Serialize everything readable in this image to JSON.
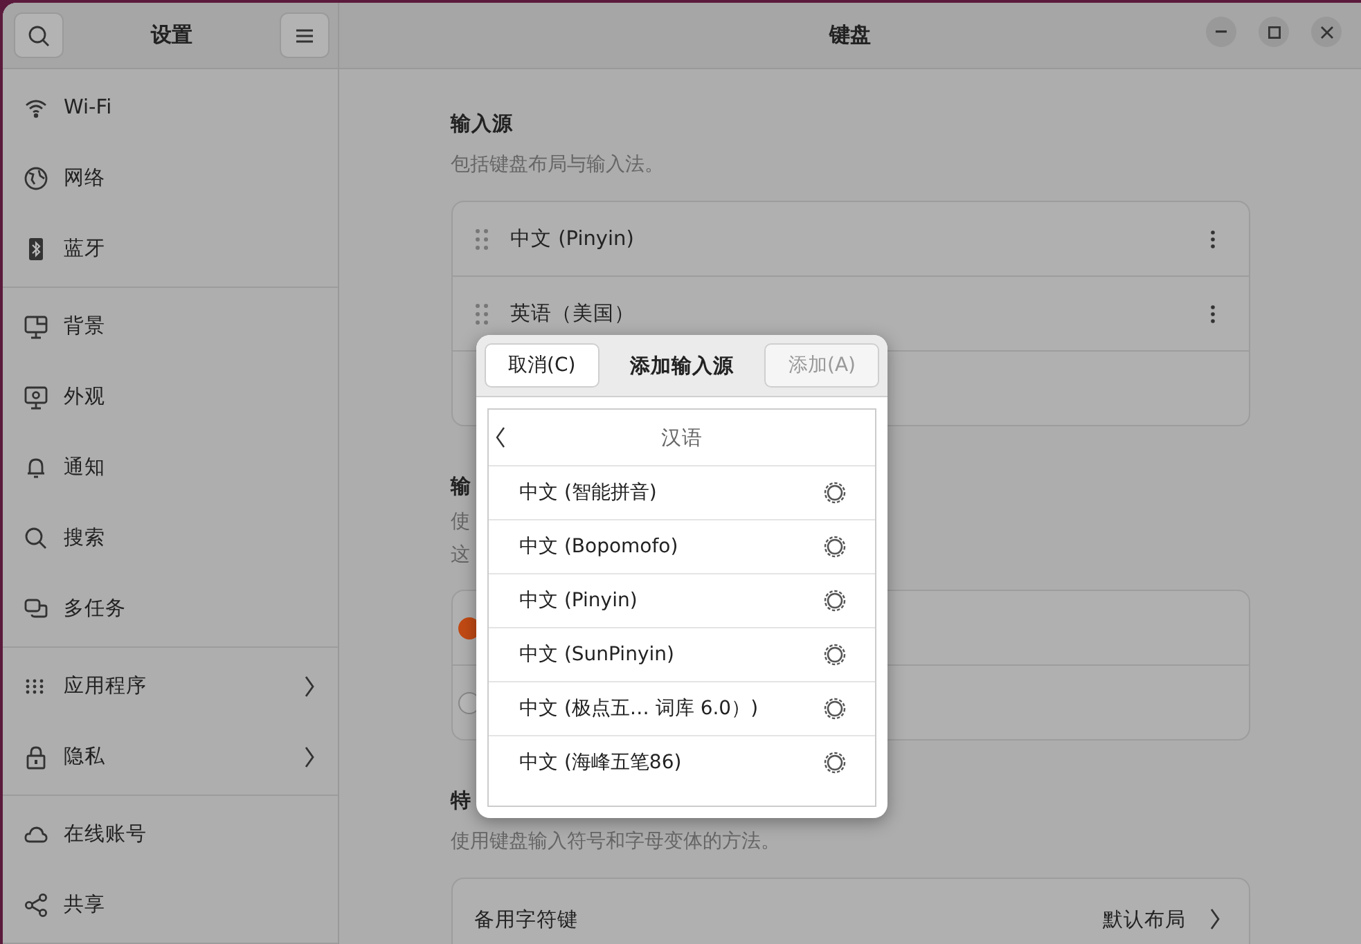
{
  "sidebar": {
    "title": "设置",
    "groups": [
      [
        {
          "label": "Wi-Fi",
          "submenu": false
        },
        {
          "label": "网络",
          "submenu": false
        },
        {
          "label": "蓝牙",
          "submenu": false
        }
      ],
      [
        {
          "label": "背景",
          "submenu": false
        },
        {
          "label": "外观",
          "submenu": false
        },
        {
          "label": "通知",
          "submenu": false
        },
        {
          "label": "搜索",
          "submenu": false
        },
        {
          "label": "多任务",
          "submenu": false
        }
      ],
      [
        {
          "label": "应用程序",
          "submenu": true
        },
        {
          "label": "隐私",
          "submenu": true
        }
      ],
      [
        {
          "label": "在线账号",
          "submenu": false
        },
        {
          "label": "共享",
          "submenu": false
        }
      ]
    ]
  },
  "window": {
    "title": "键盘"
  },
  "input_sources": {
    "heading": "输入源",
    "subtitle": "包括键盘布局与输入法。",
    "sources": [
      {
        "label": "中文 (Pinyin)"
      },
      {
        "label": "英语（美国）"
      }
    ]
  },
  "switching": {
    "heading": "输",
    "subtitle_lines": [
      "使",
      "这"
    ],
    "options": [
      {
        "selected": true
      },
      {
        "selected": false
      }
    ]
  },
  "special": {
    "heading": "特",
    "subtitle": "使用键盘输入符号和字母变体的方法。",
    "rows": [
      {
        "label": "备用字符键",
        "value": "默认布局"
      }
    ]
  },
  "dialog": {
    "cancel": "取消(C)",
    "title": "添加输入源",
    "add": {
      "label": "添加(A)",
      "disabled": true
    },
    "language": "汉语",
    "items": [
      {
        "label": "中文 (智能拼音)"
      },
      {
        "label": "中文 (Bopomofo)"
      },
      {
        "label": "中文 (Pinyin)"
      },
      {
        "label": "中文 (SunPinyin)"
      },
      {
        "label": "中文 (极点五…  词库 6.0）)"
      },
      {
        "label": "中文 (海峰五笔86)"
      }
    ]
  }
}
